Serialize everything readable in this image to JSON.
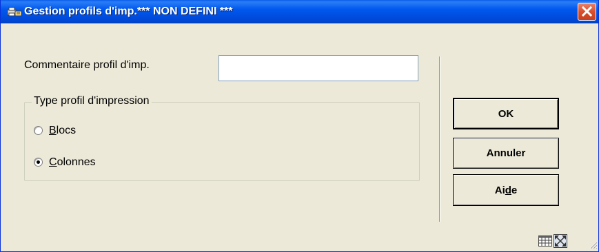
{
  "window": {
    "title": "Gestion profils d'imp.*** NON DEFINI ***",
    "icons": {
      "app": "printer-app-icon",
      "close": "close-icon"
    },
    "colors": {
      "titlebar": "#0058ee",
      "close_button": "#d8502e",
      "background": "#ece9d8"
    }
  },
  "form": {
    "comment_label": "Commentaire profil d'imp.",
    "comment_value": "",
    "group_label": "Type profil d'impression",
    "radios": [
      {
        "mnemonic": "B",
        "rest": "locs",
        "label": "Blocs",
        "selected": false
      },
      {
        "mnemonic": "C",
        "rest": "olonnes",
        "label": "Colonnes",
        "selected": true
      }
    ]
  },
  "buttons": {
    "ok": "OK",
    "cancel": "Annuler",
    "help_pre": "Ai",
    "help_mnemonic": "d",
    "help_post": "e"
  },
  "status_bar": {
    "icons": [
      "grid-icon",
      "maximize-icon",
      "resize-grip-icon"
    ]
  }
}
